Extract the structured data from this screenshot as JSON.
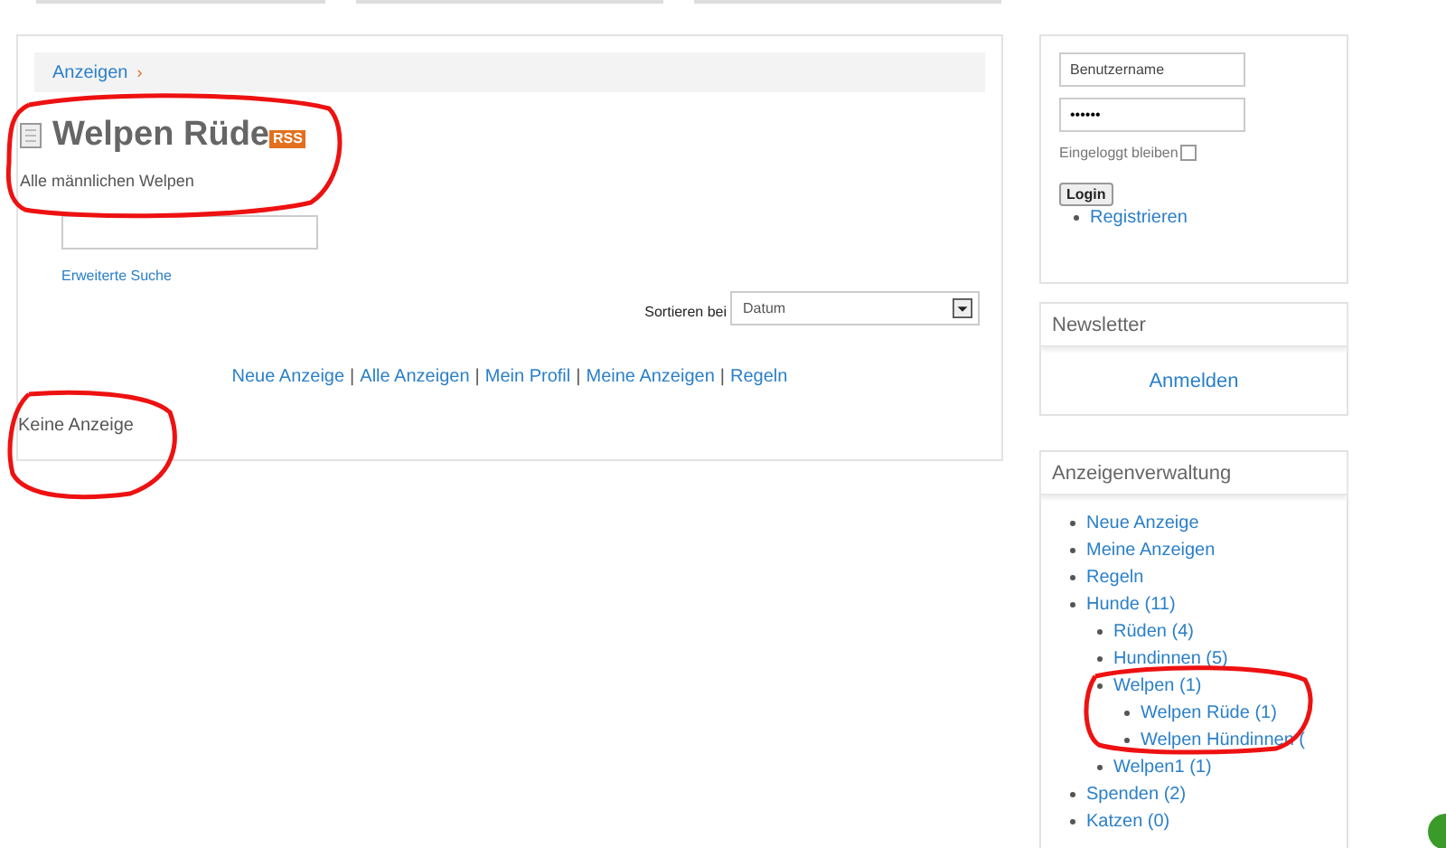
{
  "breadcrumb": {
    "items": [
      "Anzeigen"
    ],
    "separator": "›"
  },
  "heading": {
    "title": "Welpen Rüde",
    "feed_badge": "RSS",
    "description": "Alle männlichen Welpen"
  },
  "search": {
    "advanced_link": "Erweiterte Suche"
  },
  "sort": {
    "label": "Sortieren bei",
    "value": "Datum"
  },
  "nav_links": [
    "Neue Anzeige",
    "Alle Anzeigen",
    "Mein Profil",
    "Meine Anzeigen",
    "Regeln"
  ],
  "nav_separator": "|",
  "empty_message": "Keine Anzeige",
  "login": {
    "username_placeholder": "Benutzername",
    "password": "••••••",
    "remember_label": "Eingeloggt bleiben",
    "remember_checked": false,
    "button": "Login",
    "links": [
      "Registrieren"
    ]
  },
  "newsletter": {
    "title": "Newsletter",
    "link": "Anmelden"
  },
  "management": {
    "title": "Anzeigenverwaltung",
    "items": [
      {
        "label": "Neue Anzeige"
      },
      {
        "label": "Meine Anzeigen"
      },
      {
        "label": "Regeln"
      },
      {
        "label": "Hunde (11)",
        "children": [
          {
            "label": "Rüden (4)"
          },
          {
            "label": "Hundinnen (5)"
          },
          {
            "label": "Welpen (1)",
            "children": [
              {
                "label": "Welpen Rüde (1)"
              },
              {
                "label": "Welpen Hündinnen ("
              }
            ]
          },
          {
            "label": "Welpen1 (1)"
          }
        ]
      },
      {
        "label": "Spenden (2)"
      },
      {
        "label": "Katzen (0)"
      }
    ]
  }
}
